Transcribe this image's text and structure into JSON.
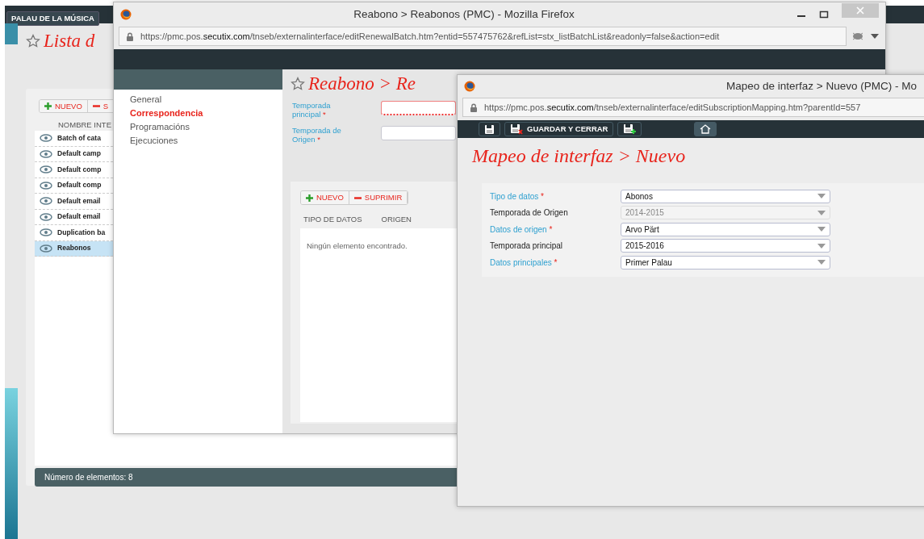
{
  "background_app": {
    "brand": "PALAU DE LA MÚSICA",
    "title": "Lista d",
    "toolbar": [
      {
        "label": "NUEVO",
        "kind": "add"
      },
      {
        "label": "S",
        "kind": "remove"
      }
    ],
    "column": "NOMBRE INTE",
    "rows": [
      {
        "name": "Batch of cata",
        "selected": false
      },
      {
        "name": "Default camp",
        "selected": false
      },
      {
        "name": "Default comp",
        "selected": false
      },
      {
        "name": "Default comp",
        "selected": false
      },
      {
        "name": "Default email",
        "selected": false
      },
      {
        "name": "Default email",
        "selected": false
      },
      {
        "name": "Duplication ba",
        "selected": false
      },
      {
        "name": "Reabonos",
        "selected": true
      }
    ],
    "footer": "Número de elementos: 8"
  },
  "renewal_window": {
    "title": "Reabono > Reabonos (PMC) - Mozilla Firefox",
    "url": "https://pmc.pos.**secutix.com**/tnseb/externalinterface/editRenewalBatch.htm?entid=557475762&refList=stx_listBatchList&readonly=false&action=edit",
    "nav": [
      {
        "label": "General",
        "selected": false
      },
      {
        "label": "Correspondencia",
        "selected": true
      },
      {
        "label": "Programacións",
        "selected": false
      },
      {
        "label": "Ejecuciones",
        "selected": false
      }
    ],
    "heading": "Reabono > Re",
    "fields": [
      {
        "label": "Temporada principal",
        "mark": "*",
        "invalid": true
      },
      {
        "label": "Temporada de Origen",
        "mark": "*",
        "invalid": false
      }
    ],
    "toolbar": [
      {
        "label": "NUEVO",
        "kind": "add"
      },
      {
        "label": "SUPRIMIR",
        "kind": "remove"
      }
    ],
    "columns": [
      "TIPO DE DATOS",
      "ORIGEN"
    ],
    "empty_message": "Ningún elemento encontrado."
  },
  "mapping_window": {
    "title": "Mapeo de interfaz > Nuevo (PMC) - Mo",
    "url": "https://pmc.pos.**secutix.com**/tnseb/externalinterface/editSubscriptionMapping.htm?parentId=557",
    "toolbar": [
      {
        "kind": "save"
      },
      {
        "kind": "save_close",
        "label": "GUARDAR Y CERRAR"
      },
      {
        "kind": "save_new"
      },
      {
        "kind": "home"
      }
    ],
    "heading": "Mapeo de interfaz > Nuevo",
    "fields": [
      {
        "label": "Tipo de datos",
        "mark": "*",
        "value": "Abonos",
        "disabled": false
      },
      {
        "label": "Temporada de Origen",
        "value": "2014-2015",
        "disabled": true
      },
      {
        "label": "Datos de origen",
        "mark": "*",
        "value": "Arvo Pärt",
        "disabled": false
      },
      {
        "label": "Temporada principal",
        "value": "2015-2016",
        "disabled": false
      },
      {
        "label": "Datos principales",
        "mark": "*",
        "value": "Primer Palau",
        "disabled": false
      }
    ]
  }
}
